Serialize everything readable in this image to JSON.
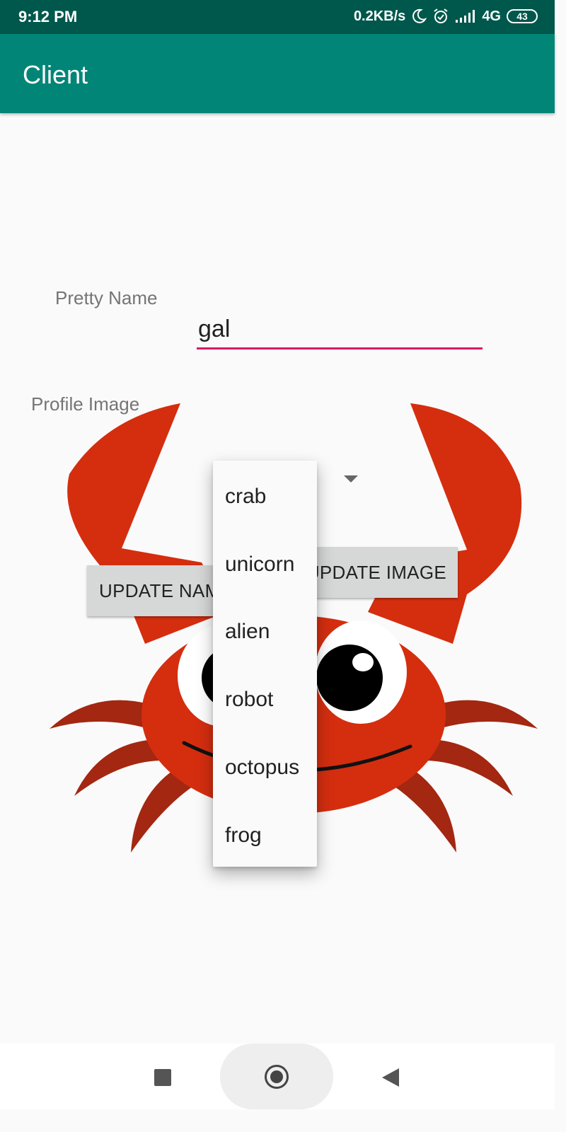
{
  "status_bar": {
    "time": "9:12 PM",
    "net_speed": "0.2KB/s",
    "network": "4G",
    "battery": "43"
  },
  "app_bar": {
    "title": "Client"
  },
  "form": {
    "name_label": "Pretty Name",
    "name_value": "gal",
    "image_label": "Profile Image",
    "update_name_label": "UPDATE NAME",
    "update_image_label": "UPDATE IMAGE"
  },
  "dropdown": {
    "options": [
      "crab",
      "unicorn",
      "alien",
      "robot",
      "octopus",
      "frog"
    ]
  },
  "colors": {
    "status_bar": "#00574b",
    "app_bar": "#008577",
    "accent": "#d81b60",
    "crab_red": "#d42e0f",
    "crab_leg": "#a32711"
  }
}
